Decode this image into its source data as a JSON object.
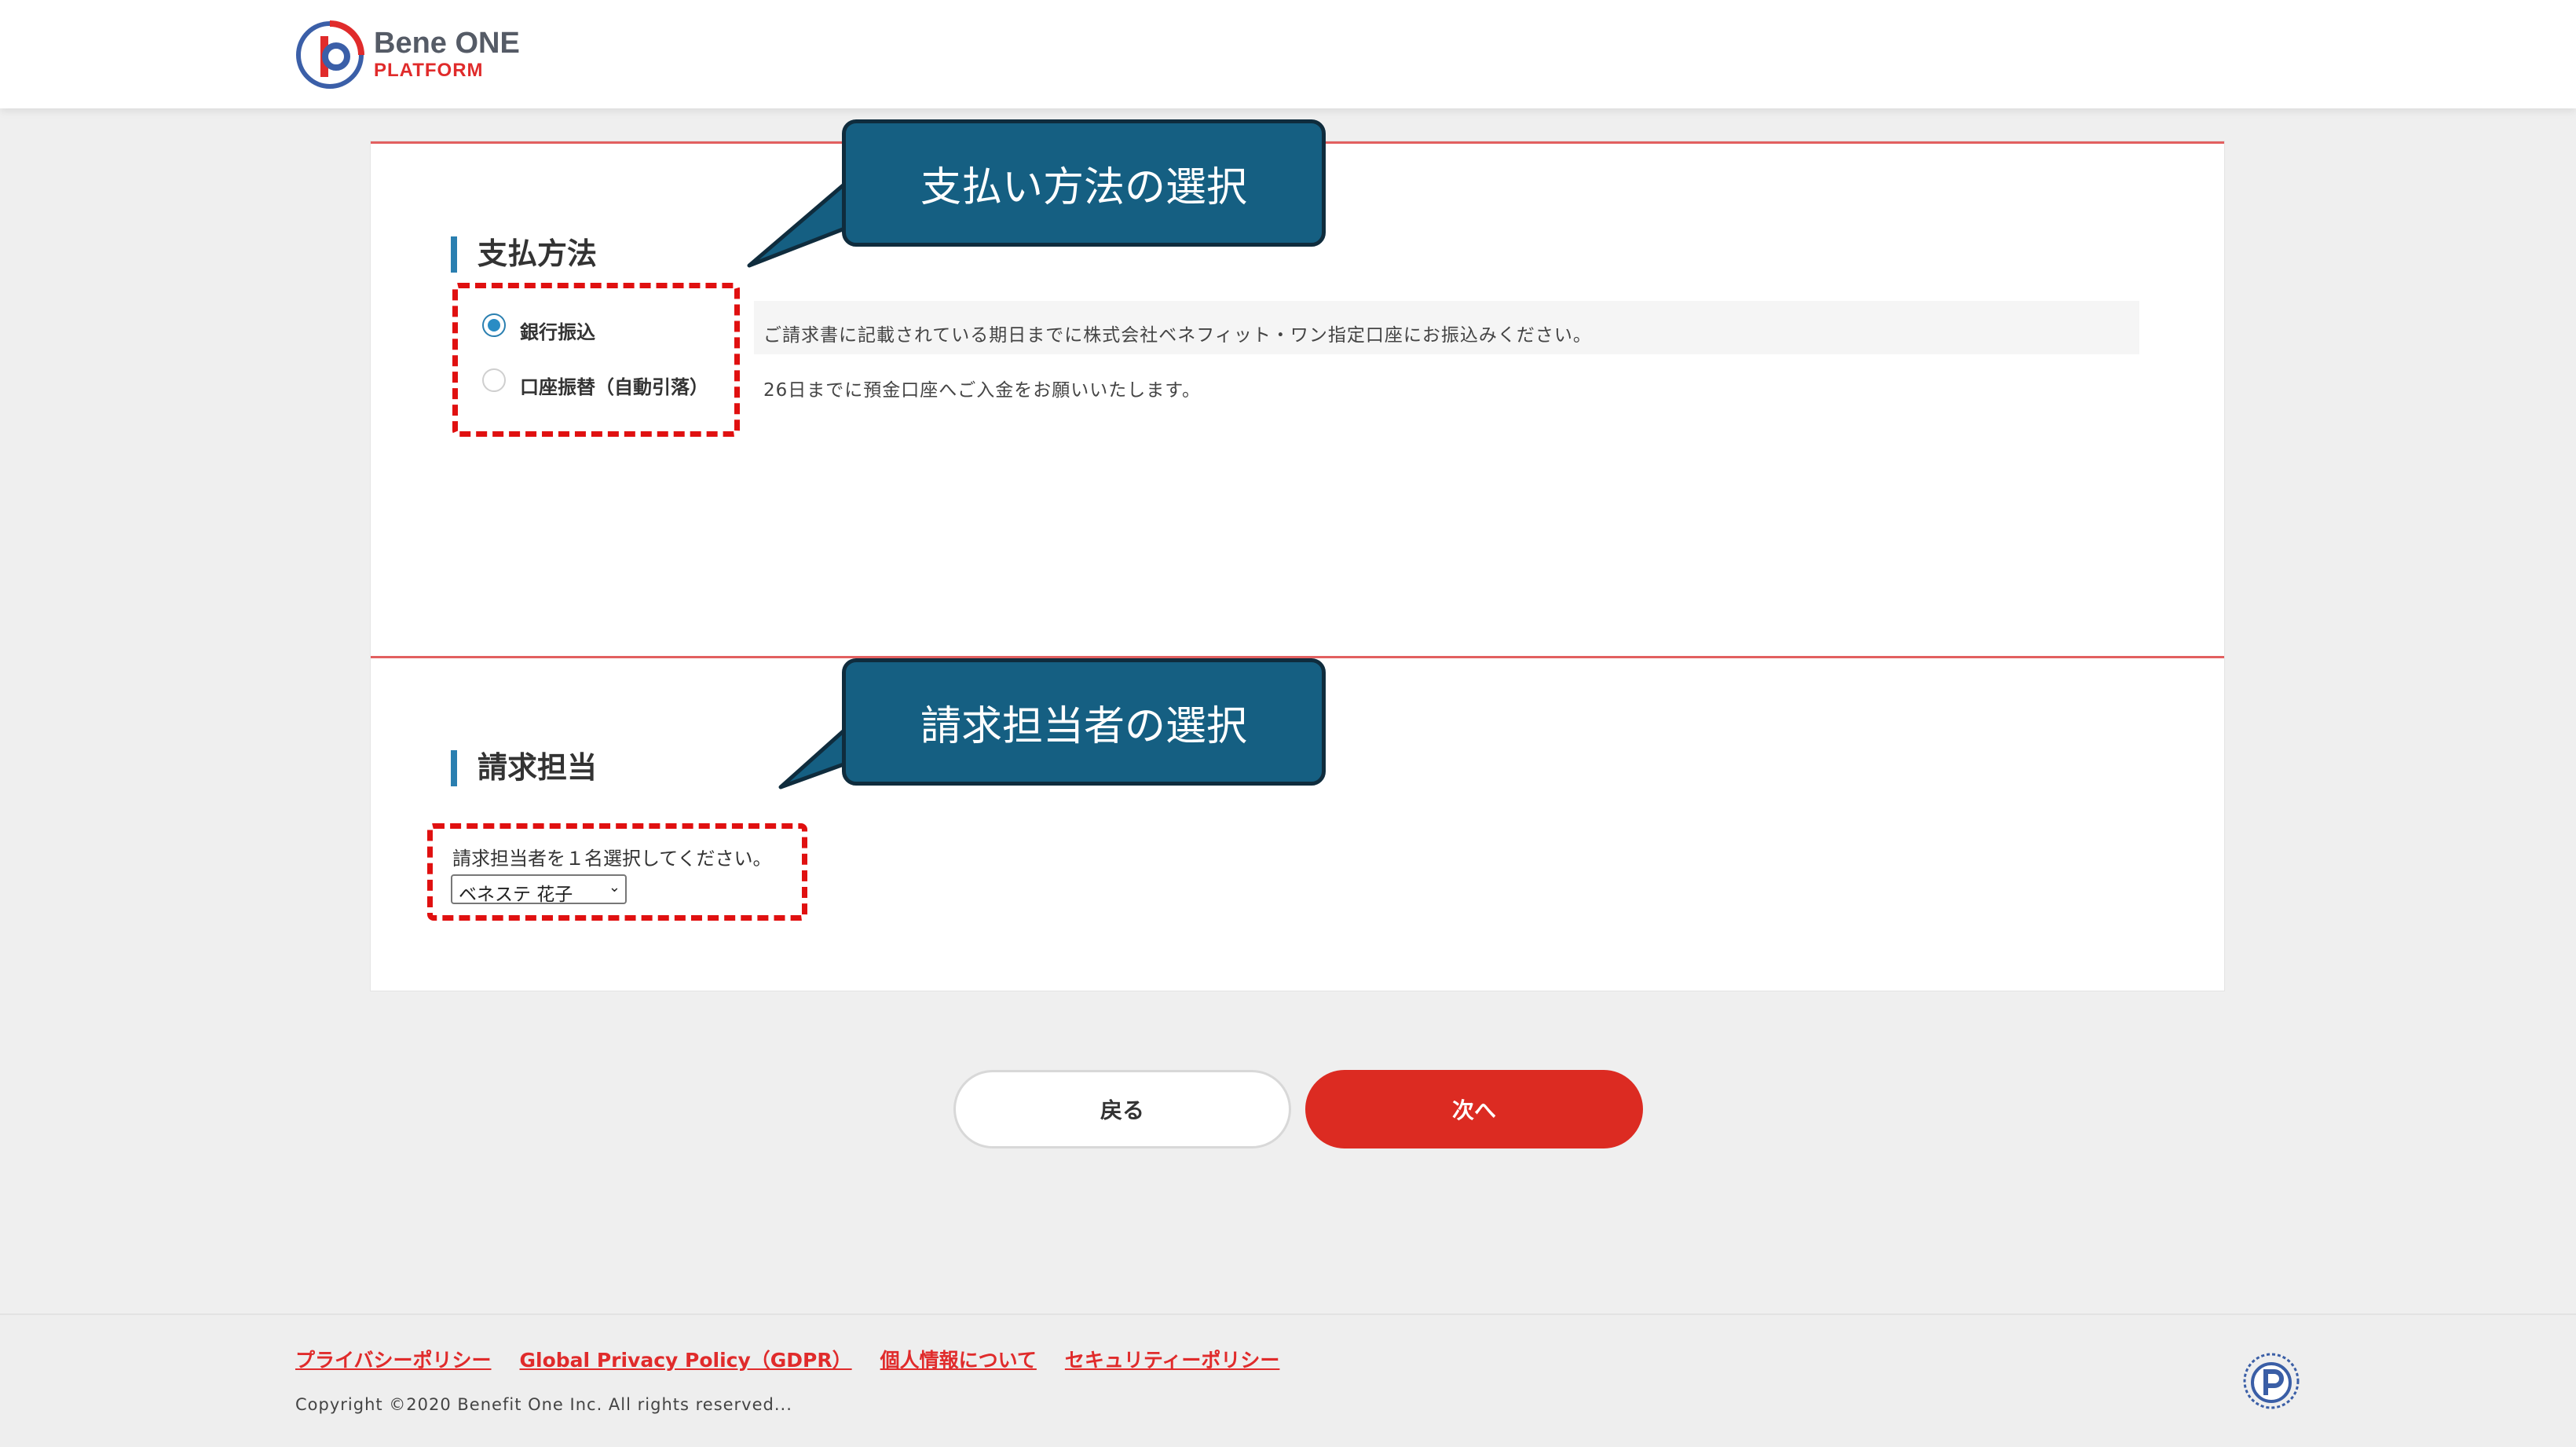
{
  "header": {
    "brand_main": "Bene ONE",
    "brand_sub": "PLATFORM"
  },
  "payment": {
    "title": "支払方法",
    "options": [
      {
        "label": "銀行振込",
        "description": "ご請求書に記載されている期日までに株式会社ベネフィット・ワン指定口座にお振込みください。",
        "selected": true
      },
      {
        "label": "口座振替（自動引落）",
        "description": "26日までに預金口座へご入金をお願いいたします。",
        "selected": false
      }
    ]
  },
  "billing": {
    "title": "請求担当",
    "prompt": "請求担当者を１名選択してください。",
    "selected_person": "ベネステ 花子"
  },
  "callouts": {
    "payment": "支払い方法の選択",
    "billing": "請求担当者の選択"
  },
  "buttons": {
    "back": "戻る",
    "next": "次へ"
  },
  "footer": {
    "links": [
      "プライバシーポリシー",
      "Global Privacy Policy（GDPR）",
      "個人情報について",
      "セキュリティーポリシー"
    ],
    "copyright": "Copyright ©2020 Benefit One Inc. All rights reserved..."
  },
  "colors": {
    "accent_red": "#dc2b22",
    "accent_blue": "#2a7fb0",
    "callout_bg": "#155f82"
  },
  "icons": {
    "logo": "bene-one-logo-icon",
    "privacy_mark": "privacy-mark-icon"
  }
}
